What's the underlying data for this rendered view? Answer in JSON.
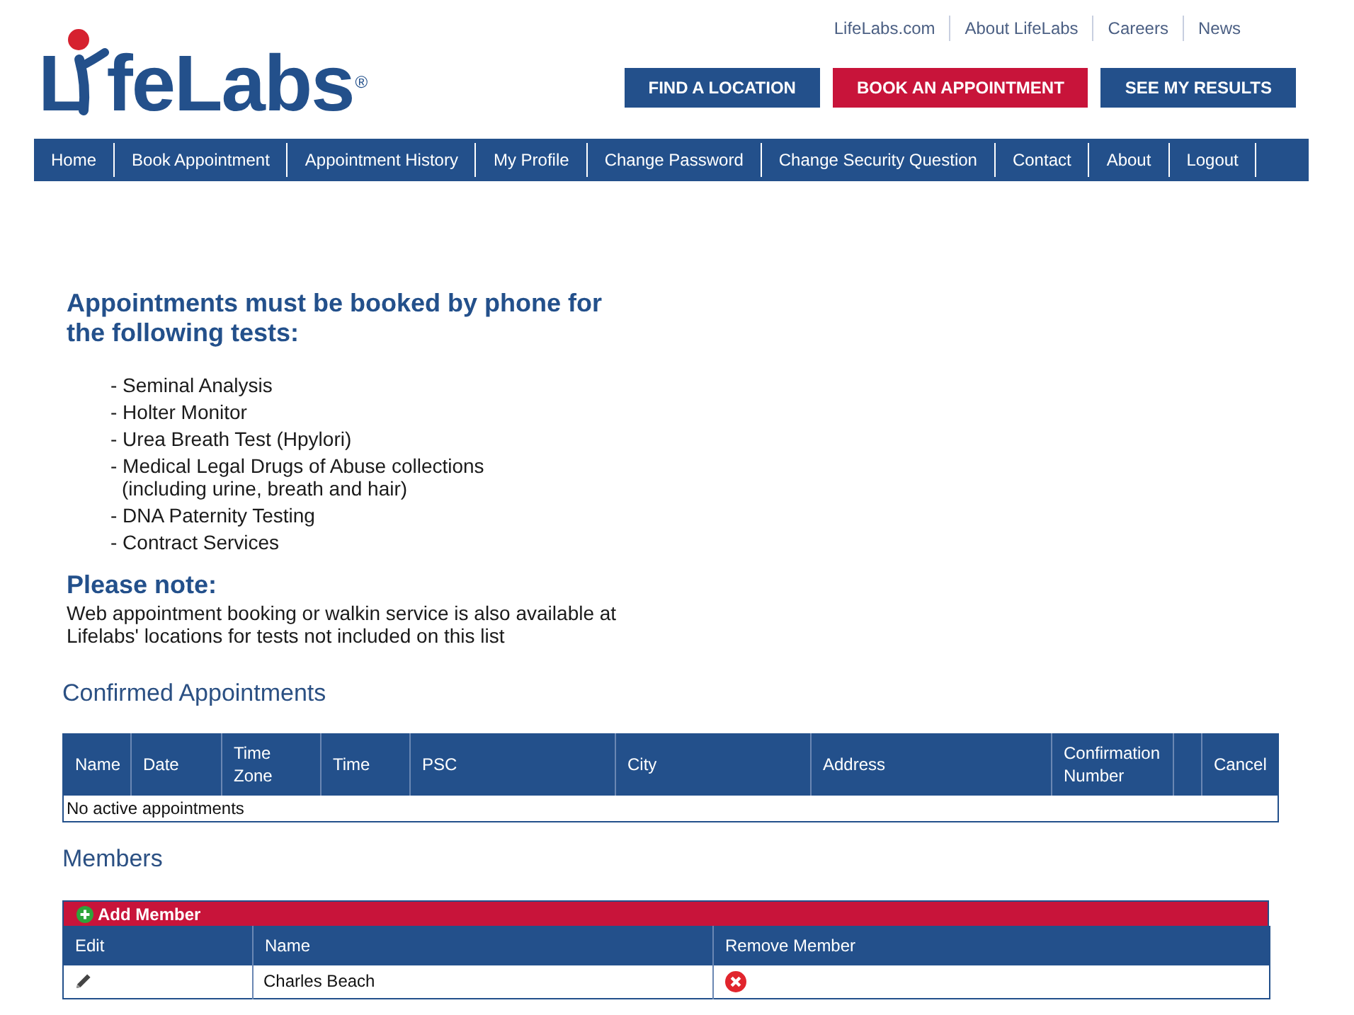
{
  "top_links": [
    "LifeLabs.com",
    "About LifeLabs",
    "Careers",
    "News"
  ],
  "logo": {
    "letter": "L",
    "word": "feLabs",
    "mark": "®"
  },
  "header_buttons": [
    {
      "label": "FIND A LOCATION",
      "kind": "standard"
    },
    {
      "label": "BOOK AN APPOINTMENT",
      "kind": "accent"
    },
    {
      "label": "SEE MY RESULTS",
      "kind": "standard"
    }
  ],
  "nav": [
    "Home",
    "Book Appointment",
    "Appointment History",
    "My Profile",
    "Change Password",
    "Change Security Question",
    "Contact",
    "About",
    "Logout"
  ],
  "notice": {
    "heading": "Appointments must be booked by phone for the following tests:",
    "tests": [
      {
        "text": "- Seminal Analysis"
      },
      {
        "text": "- Holter Monitor"
      },
      {
        "text": "- Urea Breath Test (Hpylori)"
      },
      {
        "text": "- Medical Legal Drugs of Abuse collections",
        "detail": "(including urine, breath and hair)"
      },
      {
        "text": "- DNA Paternity Testing"
      },
      {
        "text": "- Contract Services"
      }
    ],
    "note_heading": "Please note:",
    "note": "Web appointment booking or walkin service is also available at Lifelabs' locations for tests not included on this list"
  },
  "confirmed_appointments": {
    "title": "Confirmed Appointments",
    "columns": [
      {
        "kind": "text",
        "label": "Name"
      },
      {
        "kind": "text",
        "label": "Date"
      },
      {
        "kind": "text",
        "label": "Time Zone"
      },
      {
        "kind": "text",
        "label": "Time"
      },
      {
        "kind": "text",
        "label": "PSC"
      },
      {
        "kind": "text",
        "label": "City"
      },
      {
        "kind": "text",
        "label": "Address"
      },
      {
        "kind": "text",
        "label": "Confirmation Number"
      },
      {
        "kind": "blank"
      },
      {
        "kind": "text",
        "label": "Cancel"
      }
    ],
    "empty_message": "No active appointments"
  },
  "members": {
    "title": "Members",
    "add_button": "Add Member",
    "columns": [
      "Edit",
      "Name",
      "Remove Member"
    ],
    "rows": [
      {
        "name": "Charles Beach"
      }
    ]
  }
}
